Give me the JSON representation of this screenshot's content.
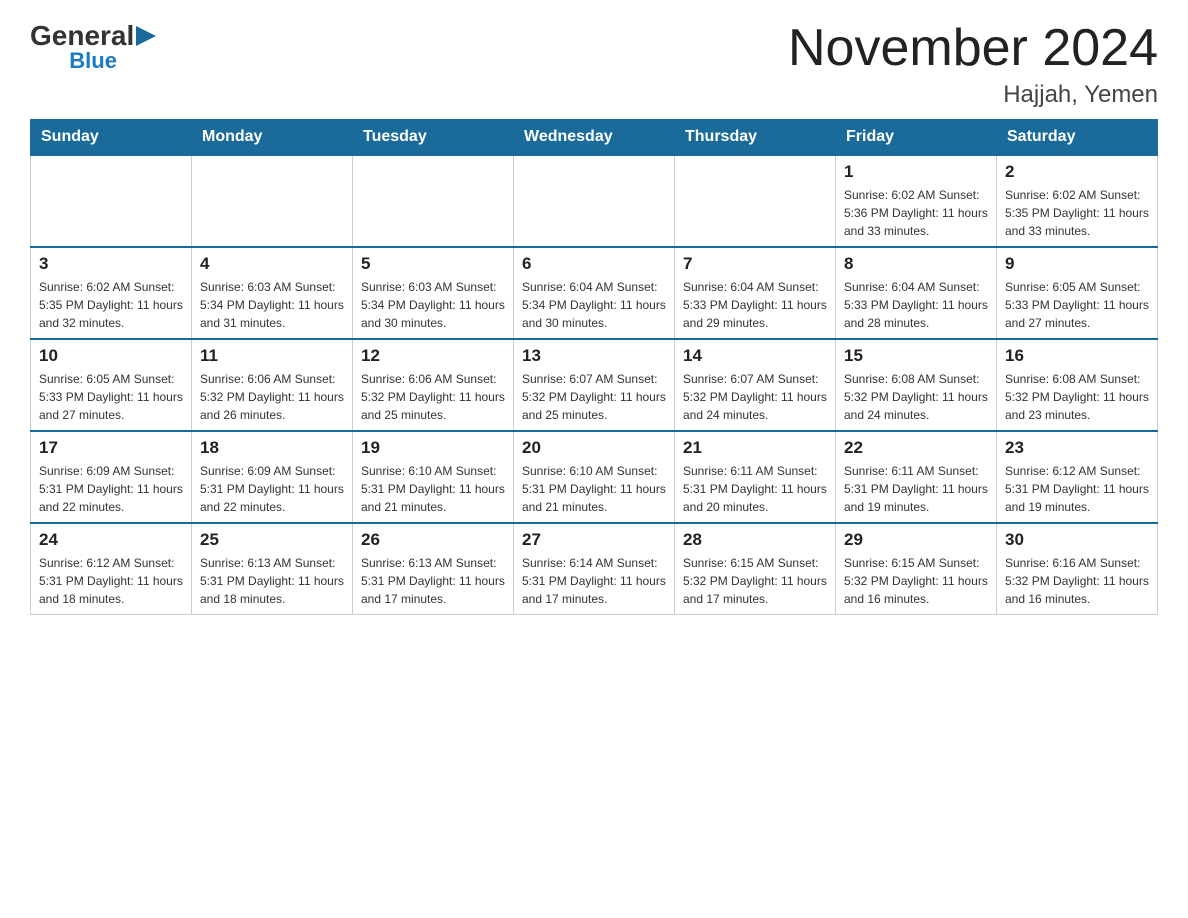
{
  "logo": {
    "general": "General",
    "blue": "Blue",
    "arrow": "▶"
  },
  "title": "November 2024",
  "subtitle": "Hajjah, Yemen",
  "days_of_week": [
    "Sunday",
    "Monday",
    "Tuesday",
    "Wednesday",
    "Thursday",
    "Friday",
    "Saturday"
  ],
  "weeks": [
    [
      {
        "day": "",
        "info": ""
      },
      {
        "day": "",
        "info": ""
      },
      {
        "day": "",
        "info": ""
      },
      {
        "day": "",
        "info": ""
      },
      {
        "day": "",
        "info": ""
      },
      {
        "day": "1",
        "info": "Sunrise: 6:02 AM\nSunset: 5:36 PM\nDaylight: 11 hours\nand 33 minutes."
      },
      {
        "day": "2",
        "info": "Sunrise: 6:02 AM\nSunset: 5:35 PM\nDaylight: 11 hours\nand 33 minutes."
      }
    ],
    [
      {
        "day": "3",
        "info": "Sunrise: 6:02 AM\nSunset: 5:35 PM\nDaylight: 11 hours\nand 32 minutes."
      },
      {
        "day": "4",
        "info": "Sunrise: 6:03 AM\nSunset: 5:34 PM\nDaylight: 11 hours\nand 31 minutes."
      },
      {
        "day": "5",
        "info": "Sunrise: 6:03 AM\nSunset: 5:34 PM\nDaylight: 11 hours\nand 30 minutes."
      },
      {
        "day": "6",
        "info": "Sunrise: 6:04 AM\nSunset: 5:34 PM\nDaylight: 11 hours\nand 30 minutes."
      },
      {
        "day": "7",
        "info": "Sunrise: 6:04 AM\nSunset: 5:33 PM\nDaylight: 11 hours\nand 29 minutes."
      },
      {
        "day": "8",
        "info": "Sunrise: 6:04 AM\nSunset: 5:33 PM\nDaylight: 11 hours\nand 28 minutes."
      },
      {
        "day": "9",
        "info": "Sunrise: 6:05 AM\nSunset: 5:33 PM\nDaylight: 11 hours\nand 27 minutes."
      }
    ],
    [
      {
        "day": "10",
        "info": "Sunrise: 6:05 AM\nSunset: 5:33 PM\nDaylight: 11 hours\nand 27 minutes."
      },
      {
        "day": "11",
        "info": "Sunrise: 6:06 AM\nSunset: 5:32 PM\nDaylight: 11 hours\nand 26 minutes."
      },
      {
        "day": "12",
        "info": "Sunrise: 6:06 AM\nSunset: 5:32 PM\nDaylight: 11 hours\nand 25 minutes."
      },
      {
        "day": "13",
        "info": "Sunrise: 6:07 AM\nSunset: 5:32 PM\nDaylight: 11 hours\nand 25 minutes."
      },
      {
        "day": "14",
        "info": "Sunrise: 6:07 AM\nSunset: 5:32 PM\nDaylight: 11 hours\nand 24 minutes."
      },
      {
        "day": "15",
        "info": "Sunrise: 6:08 AM\nSunset: 5:32 PM\nDaylight: 11 hours\nand 24 minutes."
      },
      {
        "day": "16",
        "info": "Sunrise: 6:08 AM\nSunset: 5:32 PM\nDaylight: 11 hours\nand 23 minutes."
      }
    ],
    [
      {
        "day": "17",
        "info": "Sunrise: 6:09 AM\nSunset: 5:31 PM\nDaylight: 11 hours\nand 22 minutes."
      },
      {
        "day": "18",
        "info": "Sunrise: 6:09 AM\nSunset: 5:31 PM\nDaylight: 11 hours\nand 22 minutes."
      },
      {
        "day": "19",
        "info": "Sunrise: 6:10 AM\nSunset: 5:31 PM\nDaylight: 11 hours\nand 21 minutes."
      },
      {
        "day": "20",
        "info": "Sunrise: 6:10 AM\nSunset: 5:31 PM\nDaylight: 11 hours\nand 21 minutes."
      },
      {
        "day": "21",
        "info": "Sunrise: 6:11 AM\nSunset: 5:31 PM\nDaylight: 11 hours\nand 20 minutes."
      },
      {
        "day": "22",
        "info": "Sunrise: 6:11 AM\nSunset: 5:31 PM\nDaylight: 11 hours\nand 19 minutes."
      },
      {
        "day": "23",
        "info": "Sunrise: 6:12 AM\nSunset: 5:31 PM\nDaylight: 11 hours\nand 19 minutes."
      }
    ],
    [
      {
        "day": "24",
        "info": "Sunrise: 6:12 AM\nSunset: 5:31 PM\nDaylight: 11 hours\nand 18 minutes."
      },
      {
        "day": "25",
        "info": "Sunrise: 6:13 AM\nSunset: 5:31 PM\nDaylight: 11 hours\nand 18 minutes."
      },
      {
        "day": "26",
        "info": "Sunrise: 6:13 AM\nSunset: 5:31 PM\nDaylight: 11 hours\nand 17 minutes."
      },
      {
        "day": "27",
        "info": "Sunrise: 6:14 AM\nSunset: 5:31 PM\nDaylight: 11 hours\nand 17 minutes."
      },
      {
        "day": "28",
        "info": "Sunrise: 6:15 AM\nSunset: 5:32 PM\nDaylight: 11 hours\nand 17 minutes."
      },
      {
        "day": "29",
        "info": "Sunrise: 6:15 AM\nSunset: 5:32 PM\nDaylight: 11 hours\nand 16 minutes."
      },
      {
        "day": "30",
        "info": "Sunrise: 6:16 AM\nSunset: 5:32 PM\nDaylight: 11 hours\nand 16 minutes."
      }
    ]
  ]
}
